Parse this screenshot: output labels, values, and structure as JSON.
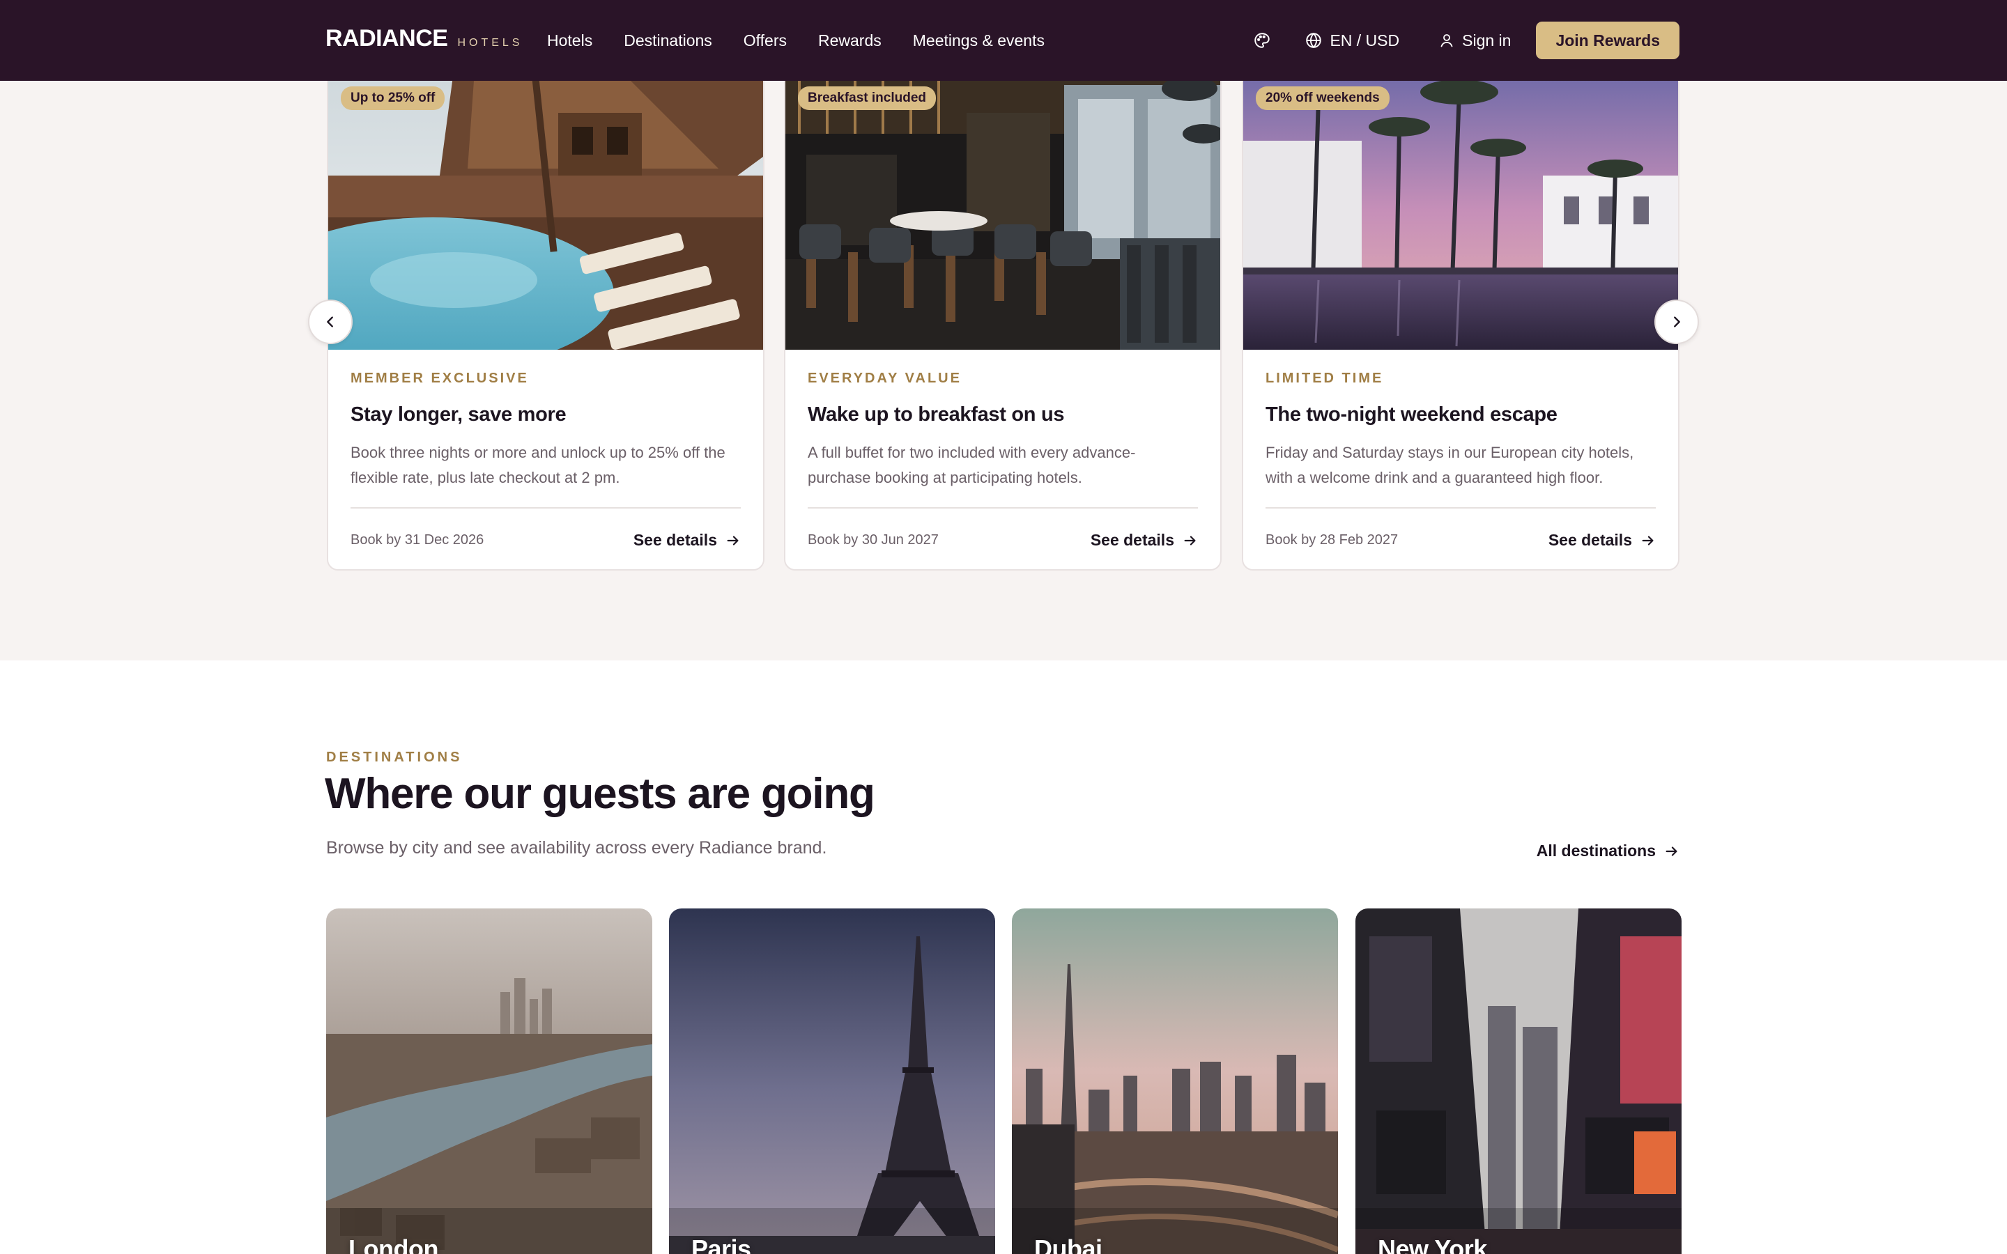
{
  "brand": {
    "name": "RADIANCE",
    "sub": "HOTELS"
  },
  "nav": {
    "items": [
      {
        "label": "Hotels"
      },
      {
        "label": "Destinations"
      },
      {
        "label": "Offers"
      },
      {
        "label": "Rewards"
      },
      {
        "label": "Meetings & events"
      }
    ],
    "language": "EN / USD",
    "sign_in": "Sign in",
    "join": "Join Rewards"
  },
  "icons": {
    "theme": "palette-icon",
    "language": "globe-icon",
    "account": "user-icon",
    "prev": "chevron-left-icon",
    "next": "chevron-right-icon",
    "link": "arrow-right-icon"
  },
  "colors": {
    "nav_bg": "#2a1428",
    "accent_gold": "#d9bd85",
    "kicker": "#a07e45",
    "section_bg": "#f7f3f2"
  },
  "offers": {
    "items": [
      {
        "badge": "Up to 25% off",
        "kicker": "MEMBER EXCLUSIVE",
        "title": "Stay longer, save more",
        "desc": "Book three nights or more and unlock up to 25% off the flexible rate, plus late checkout at 2 pm.",
        "date": "Book by 31 Dec 2026",
        "cta": "See details"
      },
      {
        "badge": "Breakfast included",
        "kicker": "EVERYDAY VALUE",
        "title": "Wake up to breakfast on us",
        "desc": "A full buffet for two included with every advance-purchase booking at participating hotels.",
        "date": "Book by 30 Jun 2027",
        "cta": "See details"
      },
      {
        "badge": "20% off weekends",
        "kicker": "LIMITED TIME",
        "title": "The two-night weekend escape",
        "desc": "Friday and Saturday stays in our European city hotels, with a welcome drink and a guaranteed high floor.",
        "date": "Book by 28 Feb 2027",
        "cta": "See details"
      }
    ]
  },
  "destinations": {
    "kicker": "DESTINATIONS",
    "title": "Where our guests are going",
    "subtitle": "Browse by city and see availability across every Radiance brand.",
    "all_link": "All destinations",
    "cities": [
      {
        "name": "London"
      },
      {
        "name": "Paris"
      },
      {
        "name": "Dubai"
      },
      {
        "name": "New York"
      }
    ]
  }
}
